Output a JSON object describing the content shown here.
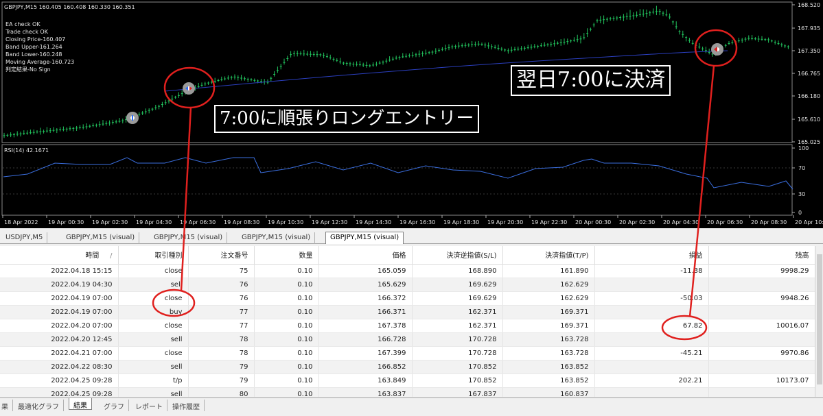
{
  "chart": {
    "symbol_header": "GBPJPY,M15  160.405 160.408 160.330 160.351",
    "status_lines": [
      "EA check OK",
      "Trade check OK",
      "Closing Price-160.407",
      "Band Upper-161.264",
      "Band Lower-160.248",
      "Moving Average-160.723",
      "判定結果-No Sign"
    ],
    "price_axis": [
      "168.520",
      "167.935",
      "167.350",
      "166.765",
      "166.180",
      "165.610",
      "165.025"
    ],
    "rsi_label": "RSI(14) 42.1671",
    "rsi_axis": [
      "100",
      "70",
      "30",
      "0"
    ],
    "time_axis": [
      "18 Apr 2022",
      "19 Apr 00:30",
      "19 Apr 02:30",
      "19 Apr 04:30",
      "19 Apr 06:30",
      "19 Apr 08:30",
      "19 Apr 10:30",
      "19 Apr 12:30",
      "19 Apr 14:30",
      "19 Apr 16:30",
      "19 Apr 18:30",
      "19 Apr 20:30",
      "19 Apr 22:30",
      "20 Apr 00:30",
      "20 Apr 02:30",
      "20 Apr 04:30",
      "20 Apr 06:30",
      "20 Apr 08:30",
      "20 Apr 10:"
    ],
    "callout_entry": "7:00に順張りロングエントリー",
    "callout_exit": "翌日7:00に決済",
    "colors": {
      "background": "#000000",
      "candles": "#22c55e",
      "ma_line": "#2b3fbf",
      "rsi_line": "#3b6fe0",
      "annotation": "#e0201e"
    }
  },
  "tabs": [
    "USDJPY,M5",
    "GBPJPY,M15 (visual)",
    "GBPJPY,M15 (visual)",
    "GBPJPY,M15 (visual)",
    "GBPJPY,M15 (visual)"
  ],
  "table": {
    "headers": [
      "時間",
      "取引種別",
      "注文番号",
      "数量",
      "価格",
      "決済逆指値(S/L)",
      "決済指値(T/P)",
      "損益",
      "残高"
    ],
    "sort_indicator": "/",
    "rows": [
      [
        "2022.04.18 15:15",
        "close",
        "75",
        "0.10",
        "165.059",
        "168.890",
        "161.890",
        "-11.38",
        "9998.29"
      ],
      [
        "2022.04.19 04:30",
        "sell",
        "76",
        "0.10",
        "165.629",
        "169.629",
        "162.629",
        "",
        ""
      ],
      [
        "2022.04.19 07:00",
        "close",
        "76",
        "0.10",
        "166.372",
        "169.629",
        "162.629",
        "-50.03",
        "9948.26"
      ],
      [
        "2022.04.19 07:00",
        "buy",
        "77",
        "0.10",
        "166.371",
        "162.371",
        "169.371",
        "",
        ""
      ],
      [
        "2022.04.20 07:00",
        "close",
        "77",
        "0.10",
        "167.378",
        "162.371",
        "169.371",
        "67.82",
        "10016.07"
      ],
      [
        "2022.04.20 12:45",
        "sell",
        "78",
        "0.10",
        "166.728",
        "170.728",
        "163.728",
        "",
        ""
      ],
      [
        "2022.04.21 07:00",
        "close",
        "78",
        "0.10",
        "167.399",
        "170.728",
        "163.728",
        "-45.21",
        "9970.86"
      ],
      [
        "2022.04.22 08:30",
        "sell",
        "79",
        "0.10",
        "166.852",
        "170.852",
        "163.852",
        "",
        ""
      ],
      [
        "2022.04.25 09:28",
        "t/p",
        "79",
        "0.10",
        "163.849",
        "170.852",
        "163.852",
        "202.21",
        "10173.07"
      ],
      [
        "2022.04.25 09:28",
        "sell",
        "80",
        "0.10",
        "163.837",
        "167.837",
        "160.837",
        "",
        ""
      ]
    ]
  },
  "bottom_tabs": [
    "果",
    "最適化グラフ",
    "結果",
    "グラフ",
    "レポート",
    "操作履歴"
  ]
}
